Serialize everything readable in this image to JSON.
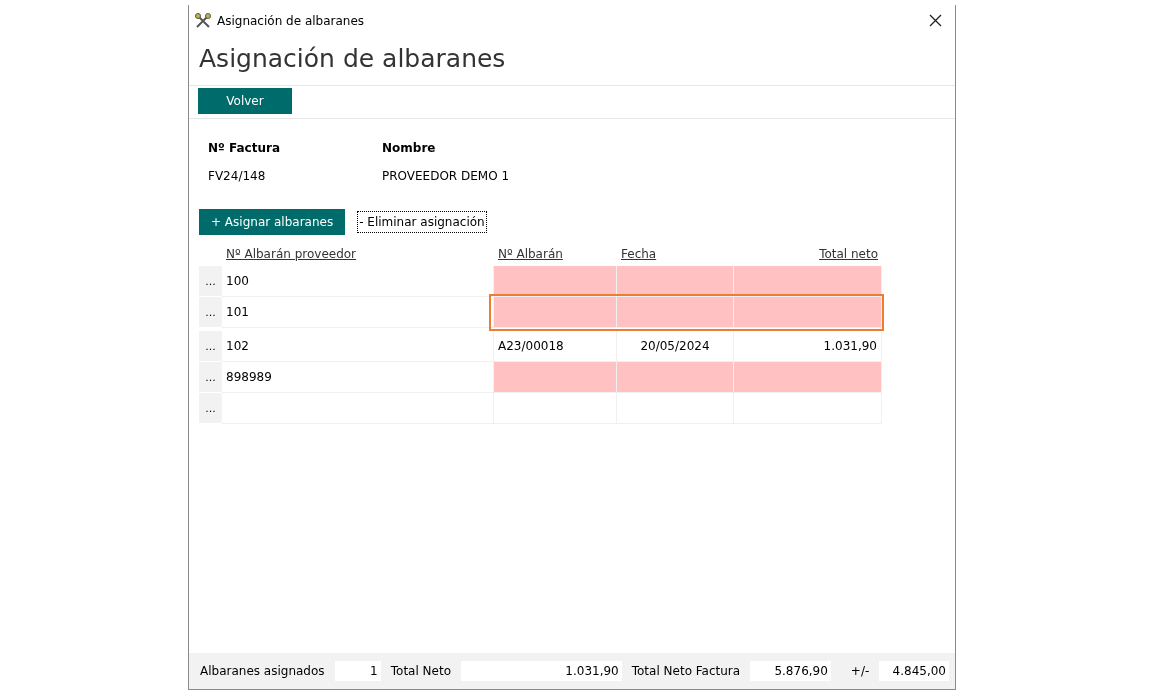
{
  "window": {
    "title": "Asignación de albaranes"
  },
  "heading": "Asignación de albaranes",
  "toolbar": {
    "buttons": [
      "Volver"
    ]
  },
  "invoice": {
    "fields": [
      {
        "label": "Nº Factura",
        "value": "FV24/148"
      },
      {
        "label": "Nombre",
        "value": "PROVEEDOR DEMO 1"
      }
    ]
  },
  "actions": [
    {
      "label": "+ Asignar albaranes",
      "kind": "primary"
    },
    {
      "label": "- Eliminar asignación",
      "kind": "focused"
    }
  ],
  "table": {
    "columns": [
      {
        "label": "Nº Albarán proveedor"
      },
      {
        "label": "Nº Albarán"
      },
      {
        "label": "Fecha"
      },
      {
        "label": "Total neto"
      }
    ],
    "rows": [
      {
        "handle": "...",
        "cells": [
          "100",
          "",
          "",
          ""
        ],
        "unmatched": true,
        "selected": false
      },
      {
        "handle": "...",
        "cells": [
          "101",
          "",
          "",
          ""
        ],
        "unmatched": true,
        "selected": true
      },
      {
        "handle": "...",
        "cells": [
          "102",
          "A23/00018",
          "20/05/2024",
          "1.031,90"
        ],
        "unmatched": false,
        "selected": false
      },
      {
        "handle": "...",
        "cells": [
          "898989",
          "",
          "",
          ""
        ],
        "unmatched": true,
        "selected": false
      },
      {
        "handle": "...",
        "cells": [
          "",
          "",
          "",
          ""
        ],
        "unmatched": false,
        "selected": false
      }
    ]
  },
  "footer": [
    {
      "label": "Albaranes asignados",
      "value": "1"
    },
    {
      "label": "Total Neto",
      "value": "1.031,90"
    },
    {
      "label": "Total Neto Factura",
      "value": "5.876,90"
    },
    {
      "label": "+/-",
      "value": "4.845,00"
    }
  ]
}
